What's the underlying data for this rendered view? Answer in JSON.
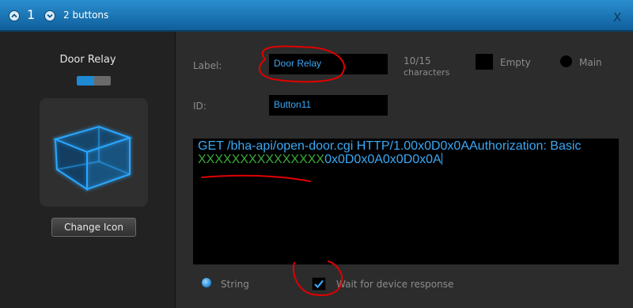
{
  "titlebar": {
    "number": "1",
    "text": "2 buttons",
    "close": "X",
    "up_icon": "chevron-up-icon",
    "down_icon": "chevron-down-icon",
    "color": "#1f7ab8"
  },
  "left_panel": {
    "title": "Door Relay",
    "icon": "3d-cube-icon",
    "change_icon_label": "Change Icon"
  },
  "form": {
    "label_caption": "Label:",
    "label_value": "Door Relay",
    "char_count": "10/15",
    "char_unit": "characters",
    "empty_label": "Empty",
    "main_label": "Main",
    "id_caption": "ID:",
    "id_value": "Button11",
    "command_line1": "GET /bha-api/open-door.cgi HTTP/1.00x0D0x0AAuthorization: Basic",
    "command_redacted": "XXXXXXXXXXXXXXX",
    "command_tail": "0x0D0x0A0x0D0x0A",
    "string_label": "String",
    "wait_label": "Wait for device response",
    "wait_checked": true
  },
  "colors": {
    "accent": "#2a8fd0",
    "text_blue": "#3aa8f5",
    "redacted_green": "#39a93a",
    "annotation_red": "#e00000"
  }
}
